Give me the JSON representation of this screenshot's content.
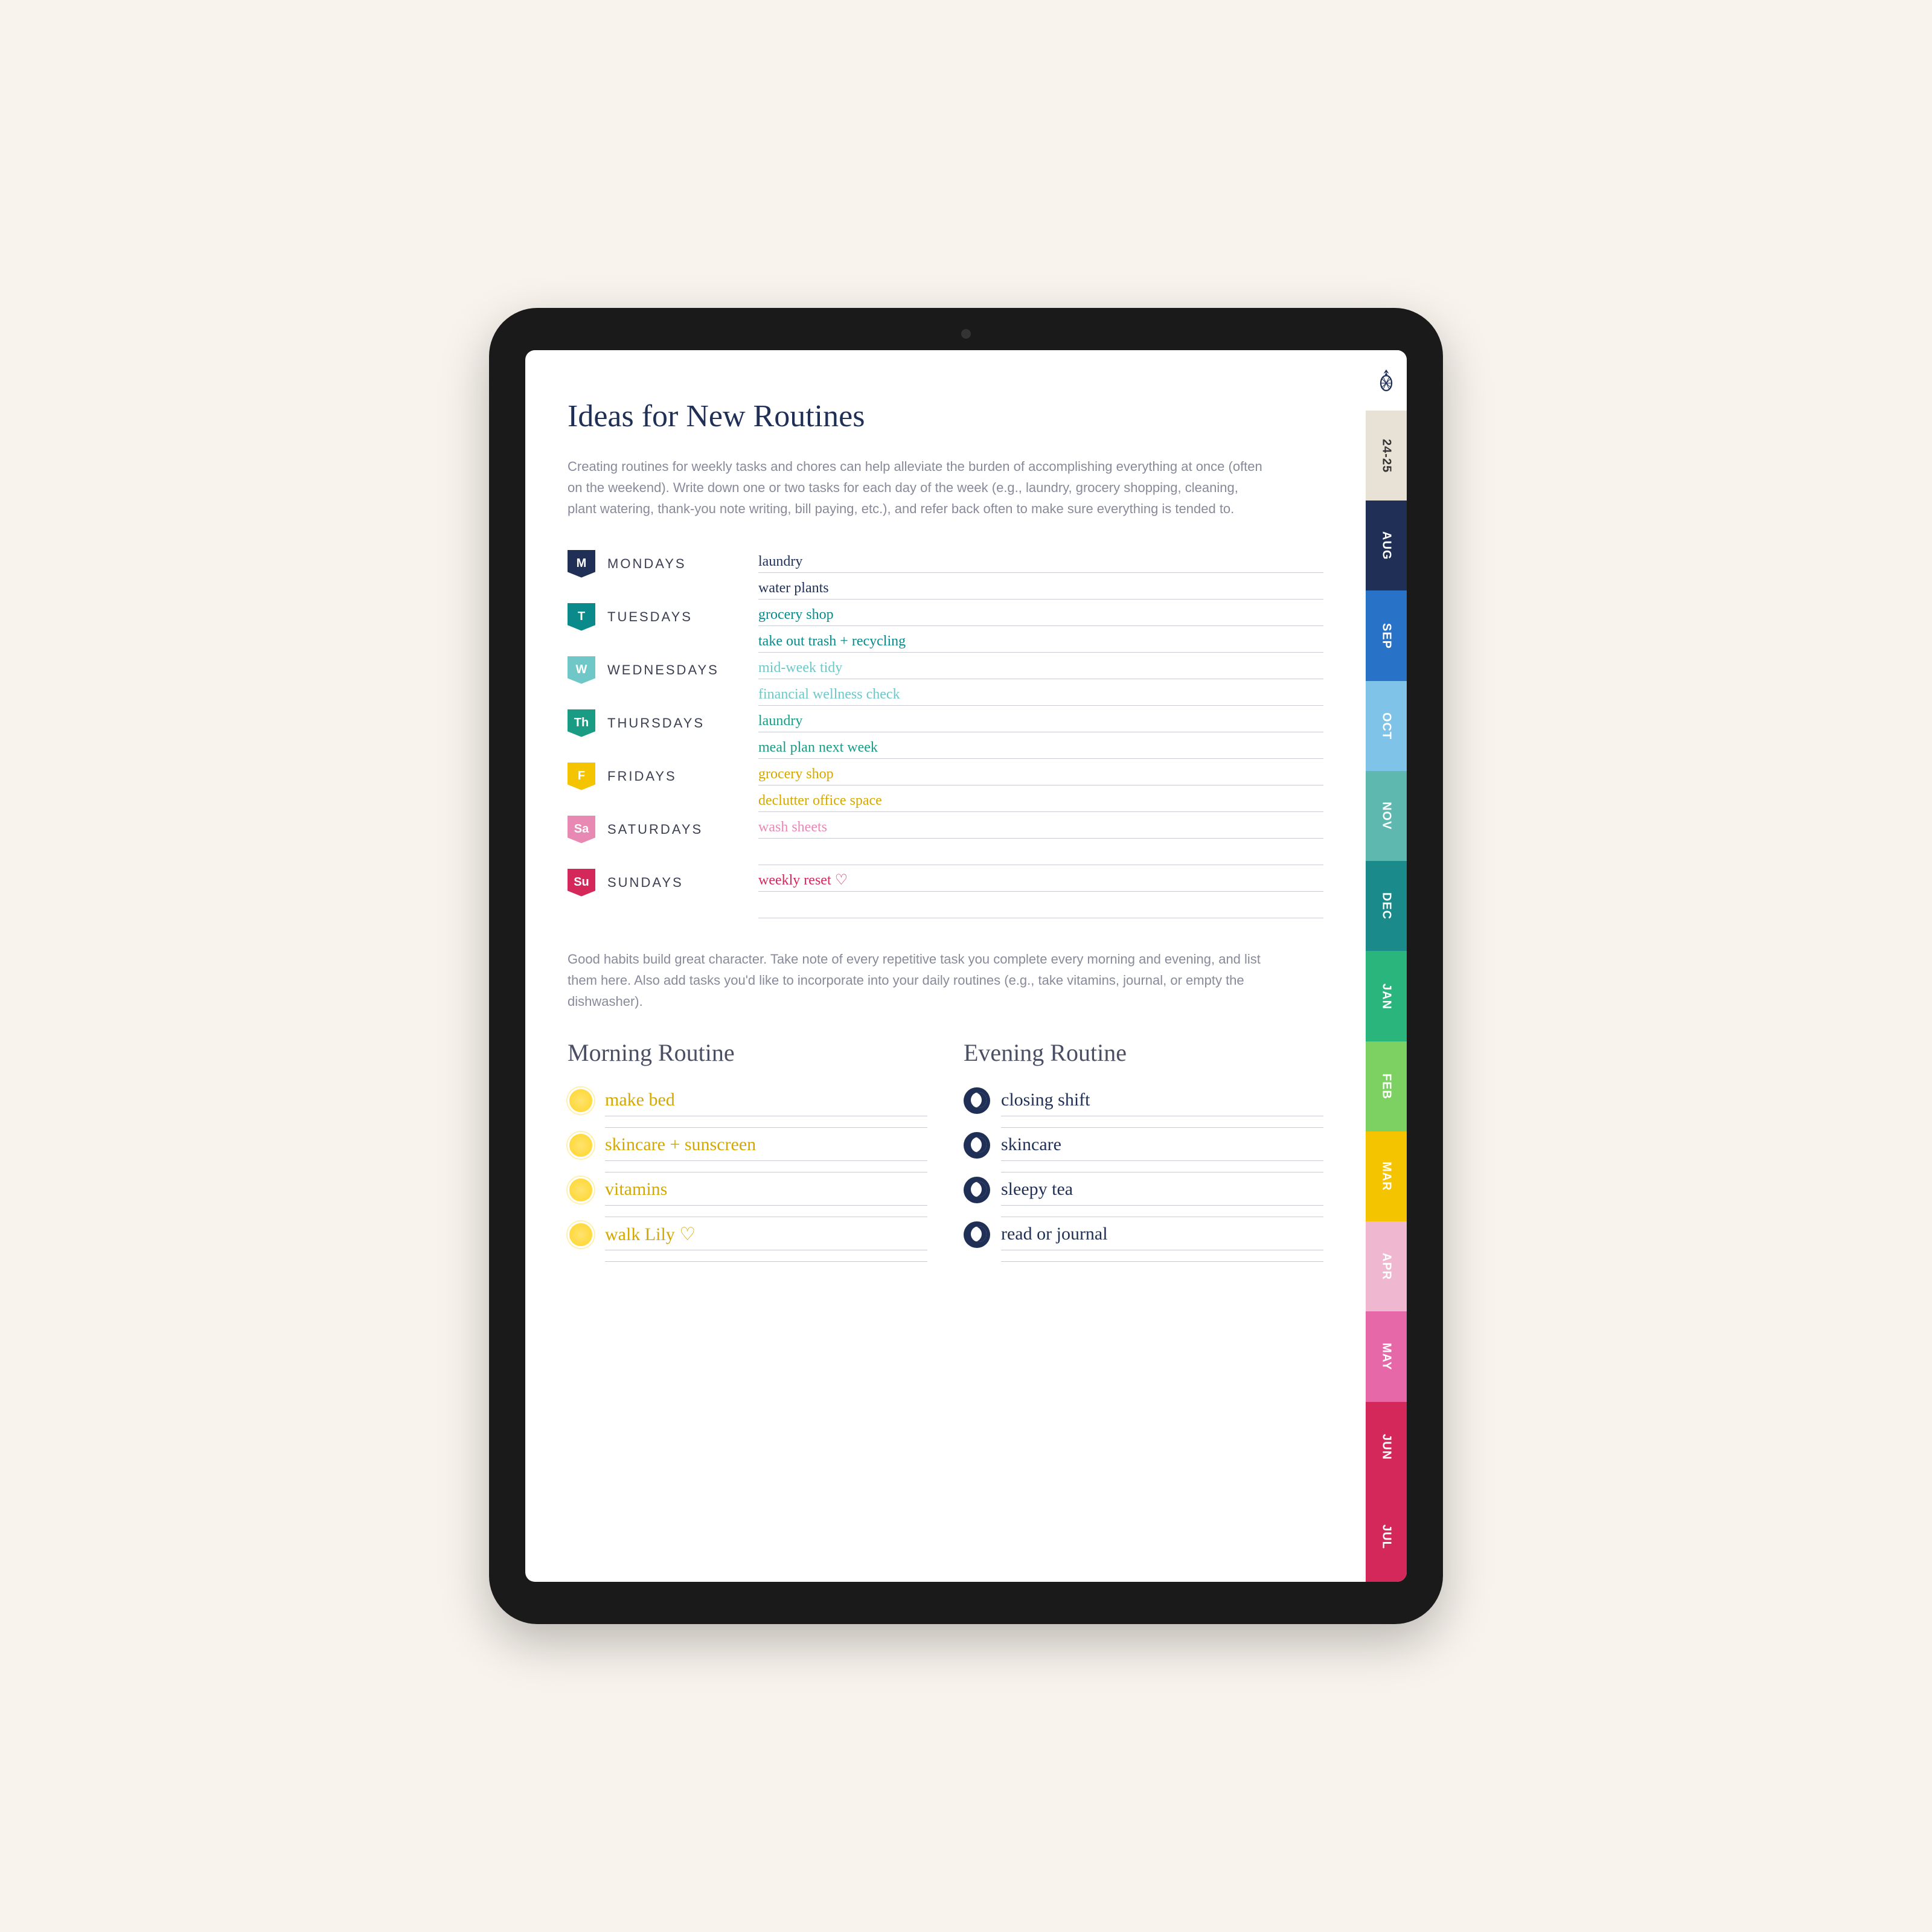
{
  "title": "Ideas for New Routines",
  "intro": "Creating routines for weekly tasks and chores can help alleviate the burden of accomplishing everything at once (often on the weekend). Write down one or two tasks for each day of the week (e.g., laundry, grocery shopping, cleaning, plant watering, thank-you note writing, bill paying, etc.), and refer back often to make sure everything is tended to.",
  "days": [
    {
      "tag": "M",
      "label": "MONDAYS",
      "color": "#1f2f55",
      "notes": [
        "laundry",
        "water plants"
      ],
      "textColor": "#1f2f55"
    },
    {
      "tag": "T",
      "label": "TUESDAYS",
      "color": "#0a8a8a",
      "notes": [
        "grocery shop",
        "take out trash + recycling"
      ],
      "textColor": "#0a8a8a"
    },
    {
      "tag": "W",
      "label": "WEDNESDAYS",
      "color": "#6fc7c7",
      "notes": [
        "mid-week tidy",
        "financial wellness check"
      ],
      "textColor": "#6fc7c7"
    },
    {
      "tag": "Th",
      "label": "THURSDAYS",
      "color": "#1a9b84",
      "notes": [
        "laundry",
        "meal plan next week"
      ],
      "textColor": "#1a9b84"
    },
    {
      "tag": "F",
      "label": "FRIDAYS",
      "color": "#f5c400",
      "notes": [
        "grocery shop",
        "declutter office space"
      ],
      "textColor": "#d4a800"
    },
    {
      "tag": "Sa",
      "label": "SATURDAYS",
      "color": "#e889b4",
      "notes": [
        "wash sheets",
        ""
      ],
      "textColor": "#e889b4"
    },
    {
      "tag": "Su",
      "label": "SUNDAYS",
      "color": "#d4285a",
      "notes": [
        "weekly reset ♡",
        ""
      ],
      "textColor": "#d4285a"
    }
  ],
  "mid": "Good habits build great character. Take note of every repetitive task you complete every morning and evening, and list them here. Also add tasks you'd like to incorporate into your daily routines (e.g., take vitamins, journal, or empty the dishwasher).",
  "morning": {
    "title": "Morning Routine",
    "items": [
      "make bed",
      "skincare + sunscreen",
      "vitamins",
      "walk Lily ♡"
    ]
  },
  "evening": {
    "title": "Evening Routine",
    "items": [
      "closing shift",
      "skincare",
      "sleepy tea",
      "read or journal"
    ]
  },
  "tabs": [
    {
      "label": "24-25",
      "color": "#e8e1d6",
      "light": true
    },
    {
      "label": "AUG",
      "color": "#1f2f55"
    },
    {
      "label": "SEP",
      "color": "#2873c7"
    },
    {
      "label": "OCT",
      "color": "#7fc4e8"
    },
    {
      "label": "NOV",
      "color": "#5fb8b0"
    },
    {
      "label": "DEC",
      "color": "#1a8a8a"
    },
    {
      "label": "JAN",
      "color": "#2ab57d"
    },
    {
      "label": "FEB",
      "color": "#7dd162"
    },
    {
      "label": "MAR",
      "color": "#f5c400"
    },
    {
      "label": "APR",
      "color": "#f0b8d0"
    },
    {
      "label": "MAY",
      "color": "#e668a8"
    },
    {
      "label": "JUN",
      "color": "#d4285a"
    },
    {
      "label": "JUL",
      "color": "#d4285a"
    }
  ]
}
